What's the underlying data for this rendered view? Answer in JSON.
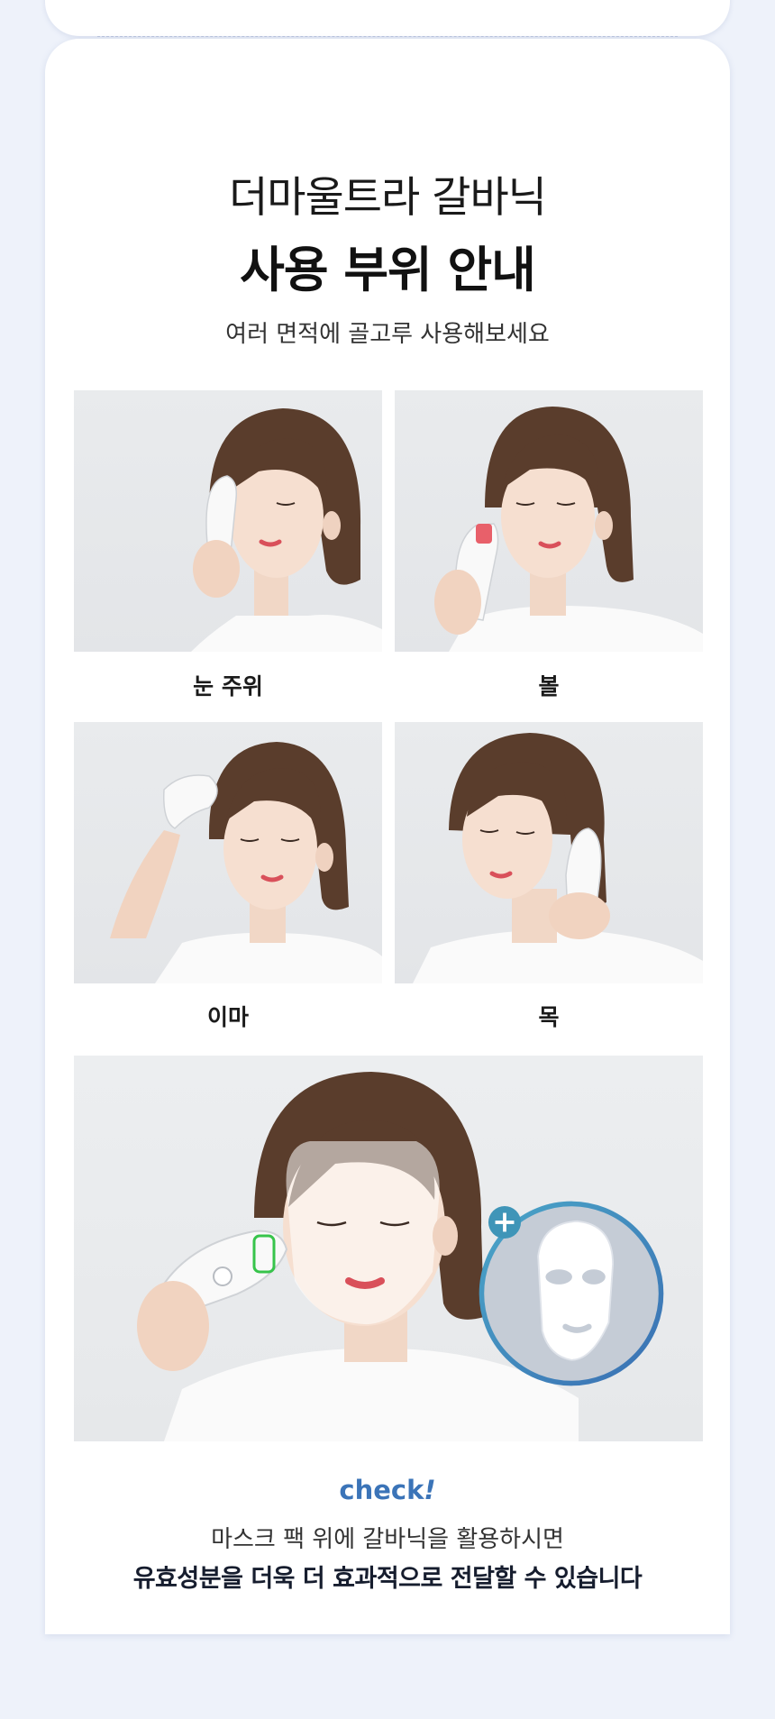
{
  "header": {
    "title_light": "더마울트라 갈바닉",
    "title_bold": "사용 부위 안내",
    "subtitle": "여러 면적에 골고루 사용해보세요"
  },
  "areas": [
    {
      "label": "눈 주위",
      "photo_icon": "woman-device-eye-photo"
    },
    {
      "label": "볼",
      "photo_icon": "woman-device-cheek-photo"
    },
    {
      "label": "이마",
      "photo_icon": "woman-device-forehead-photo"
    },
    {
      "label": "목",
      "photo_icon": "woman-device-neck-photo"
    }
  ],
  "mask_section": {
    "photo_icon": "woman-sheet-mask-device-photo",
    "badge_icon": "plus-icon",
    "mask_icon": "face-mask-icon"
  },
  "check": {
    "label": "check",
    "mark": "!",
    "line1": "마스크 팩 위에 갈바닉을 활용하시면",
    "line2": "유효성분을 더욱 더 효과적으로 전달할 수 있습니다"
  },
  "colors": {
    "background": "#eef2fa",
    "accent_blue": "#3b74b8",
    "badge_teal": "#3f95b8"
  }
}
